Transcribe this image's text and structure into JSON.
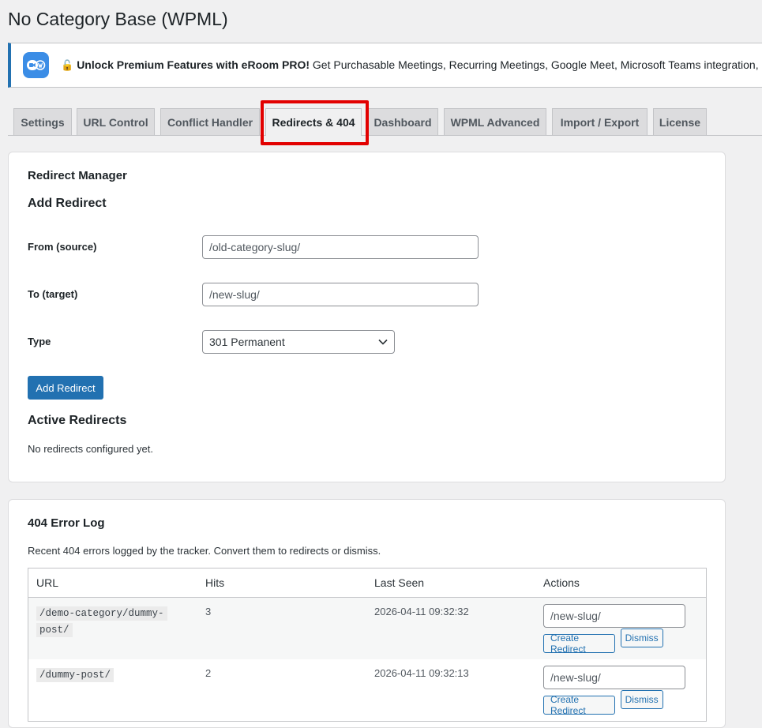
{
  "page": {
    "title": "No Category Base (WPML)"
  },
  "notice": {
    "lock_icon": "🔓",
    "headline": "Unlock Premium Features with eRoom PRO!",
    "body": " Get Purchasable Meetings, Recurring Meetings, Google Meet, Microsoft Teams integration, and"
  },
  "tabs": [
    {
      "label": "Settings"
    },
    {
      "label": "URL Control"
    },
    {
      "label": "Conflict Handler"
    },
    {
      "label": "Redirects & 404",
      "active": true
    },
    {
      "label": "Dashboard"
    },
    {
      "label": "WPML Advanced"
    },
    {
      "label": "Import / Export"
    },
    {
      "label": "License"
    }
  ],
  "redirect_manager": {
    "title": "Redirect Manager",
    "add_title": "Add Redirect",
    "from_label": "From (source)",
    "from_placeholder": "/old-category-slug/",
    "to_label": "To (target)",
    "to_placeholder": "/new-slug/",
    "type_label": "Type",
    "type_value": "301 Permanent",
    "add_button": "Add Redirect",
    "active_title": "Active Redirects",
    "empty_text": "No redirects configured yet."
  },
  "error_log": {
    "title": "404 Error Log",
    "description": "Recent 404 errors logged by the tracker. Convert them to redirects or dismiss.",
    "columns": [
      "URL",
      "Hits",
      "Last Seen",
      "Actions"
    ],
    "rows": [
      {
        "url": "/demo-category/dummy-post/",
        "hits": "3",
        "last_seen": "2026-04-11 09:32:32",
        "target_placeholder": "/new-slug/"
      },
      {
        "url": "/dummy-post/",
        "hits": "2",
        "last_seen": "2026-04-11 09:32:13",
        "target_placeholder": "/new-slug/"
      }
    ],
    "create_button": "Create Redirect",
    "dismiss_button": "Dismiss"
  },
  "colors": {
    "accent": "#2271b1",
    "highlight": "#e20000"
  }
}
